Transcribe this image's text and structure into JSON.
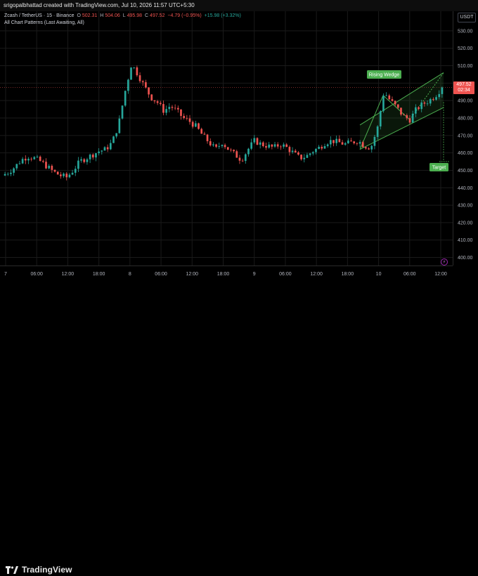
{
  "header": {
    "created_by": "srigopalbhattad created with TradingView.com, Jul 10, 2026 11:57 UTC+5:30"
  },
  "legend": {
    "symbol": "Zcash / TetherUS · 15 · Binance",
    "open_label": "O",
    "open": "502.31",
    "high_label": "H",
    "high": "504.06",
    "low_label": "L",
    "low": "495.98",
    "close_label": "C",
    "close": "497.52",
    "change": "−4.79 (−0.95%)",
    "volume_change": "+15.98 (+3.32%)",
    "indicator": "All Chart Patterns (Last Awaiting, All)"
  },
  "price_axis": {
    "currency": "USDT",
    "current_price": "497.52",
    "countdown": "02:34"
  },
  "annotations": {
    "pattern_label": "Rising Wedge",
    "target_label": "Target"
  },
  "brand": {
    "name": "TradingView"
  },
  "colors": {
    "up": "#26a69a",
    "down": "#ef5350",
    "pattern": "#4caf50",
    "background": "#000000"
  },
  "chart_data": {
    "type": "candlestick",
    "y_ticks": [
      400,
      410,
      420,
      430,
      440,
      450,
      460,
      470,
      480,
      490,
      500,
      510,
      520,
      530
    ],
    "ylim": [
      397,
      536
    ],
    "x_ticks": [
      "7",
      "06:00",
      "12:00",
      "18:00",
      "8",
      "06:00",
      "12:00",
      "18:00",
      "9",
      "06:00",
      "12:00",
      "18:00",
      "10",
      "06:00",
      "12:00"
    ],
    "series": [
      {
        "name": "close_path",
        "values": [
          447,
          449,
          452,
          456,
          458,
          457,
          455,
          452,
          449,
          447,
          446,
          450,
          455,
          457,
          459,
          461,
          462,
          466,
          476,
          495,
          511,
          505,
          498,
          492,
          489,
          484,
          487,
          484,
          480,
          478,
          475,
          470,
          466,
          462,
          466,
          462,
          459,
          456,
          462,
          467,
          465,
          464,
          463,
          465,
          463,
          460,
          457,
          458,
          461,
          463,
          466,
          467,
          466,
          465,
          466,
          467,
          464,
          463,
          474,
          495,
          490,
          486,
          481,
          479,
          485,
          488,
          490,
          493,
          497.52
        ]
      }
    ],
    "wedge": {
      "upper": [
        [
          0,
          476
        ],
        [
          1,
          506
        ]
      ],
      "lower": [
        [
          0,
          462
        ],
        [
          1,
          486
        ]
      ],
      "target": 455
    }
  }
}
